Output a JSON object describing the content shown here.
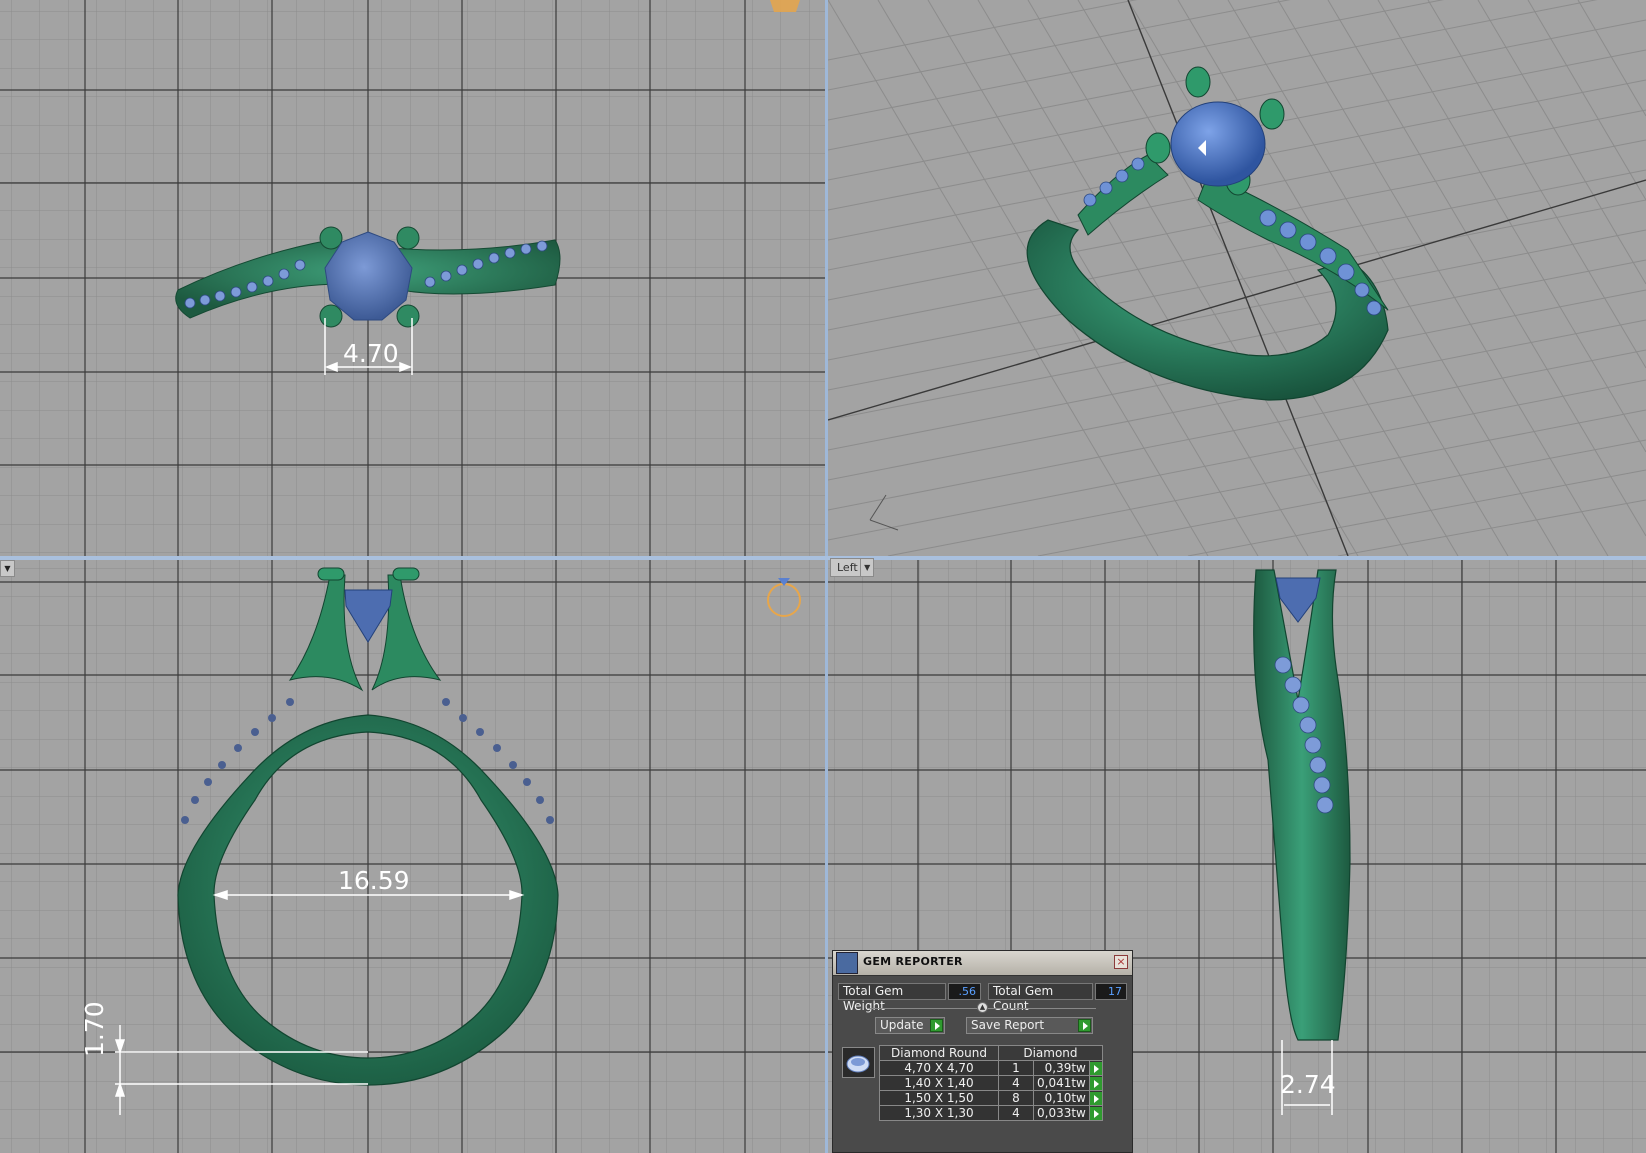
{
  "viewports": {
    "top": {
      "dimension": "4.70"
    },
    "perspective": {},
    "front": {
      "ring_inner_dimension": "16.59",
      "band_thickness": "1.70"
    },
    "left": {
      "label": "Left",
      "band_width": "2.74"
    }
  },
  "gem_reporter": {
    "title": "GEM REPORTER",
    "close": "×",
    "total_gem_weight_label": "Total Gem Weight",
    "total_gem_weight_value": ".56",
    "total_gem_count_label": "Total Gem Count",
    "total_gem_count_value": "17",
    "update_label": "Update",
    "save_report_label": "Save Report",
    "table": {
      "headers": [
        "Diamond Round",
        "Diamond"
      ],
      "rows": [
        {
          "size": "4,70 X 4,70",
          "qty": "1",
          "weight": "0,39tw"
        },
        {
          "size": "1,40 X 1,40",
          "qty": "4",
          "weight": "0,041tw"
        },
        {
          "size": "1,50 X 1,50",
          "qty": "8",
          "weight": "0,10tw"
        },
        {
          "size": "1,30 X 1,30",
          "qty": "4",
          "weight": "0,033tw"
        }
      ]
    }
  },
  "colors": {
    "background": "#9f9f9f",
    "grid_minor": "#8a8a8a",
    "grid_major": "#3d3d3d",
    "metal": "#2a7a5a",
    "gem": "#4a6fb0",
    "accent_green": "#2f9a2f"
  }
}
